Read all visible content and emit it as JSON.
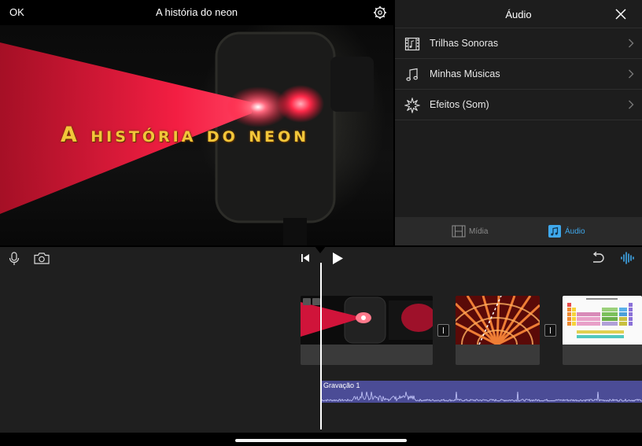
{
  "viewer": {
    "ok_label": "OK",
    "project_title": "A história do neon",
    "overlay_title": "A história do neon"
  },
  "audio_panel": {
    "title": "Áudio",
    "items": [
      {
        "label": "Trilhas Sonoras",
        "icon": "film-strip-icon"
      },
      {
        "label": "Minhas Músicas",
        "icon": "music-note-icon"
      },
      {
        "label": "Efeitos (Som)",
        "icon": "starburst-icon"
      }
    ],
    "tabs": [
      {
        "label": "Mídia",
        "icon": "film-icon",
        "selected": false
      },
      {
        "label": "Áudio",
        "icon": "music-note-icon",
        "selected": true
      }
    ],
    "accent_color": "#3fa8ec"
  },
  "timeline": {
    "audio_clip_label": "Gravação 1",
    "audio_clip_color": "#4b4c96",
    "clips": [
      {
        "name": "neon laser clip"
      },
      {
        "name": "neon tubes clip"
      },
      {
        "name": "periodic table clip"
      }
    ]
  }
}
